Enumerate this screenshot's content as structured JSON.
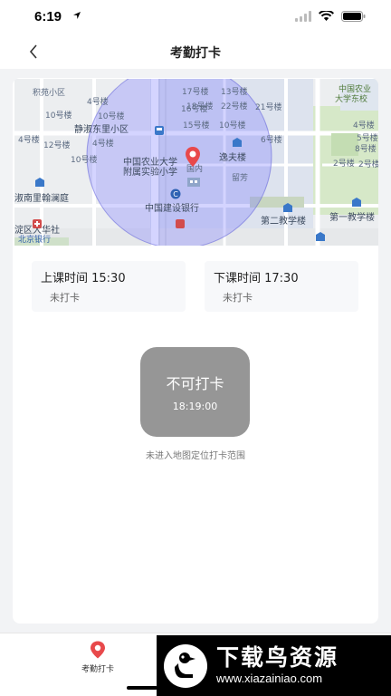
{
  "status_bar": {
    "time": "6:19",
    "icons": [
      "location-arrow-icon",
      "signal-icon",
      "wifi-icon",
      "battery-icon"
    ]
  },
  "nav": {
    "back_icon": "chevron-left-icon",
    "title": "考勤打卡"
  },
  "map": {
    "labels": [
      "积苑小区",
      "4号楼",
      "10号楼",
      "10号楼",
      "静淑东里小区",
      "4号楼",
      "12号楼",
      "4号楼",
      "10号楼",
      "中国农业大学",
      "附属实验小学",
      "中国建设银行",
      "淑南里翰澜庭",
      "淀区大华社",
      "北京银行",
      "17号楼",
      "13号楼",
      "18号楼",
      "22号楼",
      "16号楼",
      "21号楼",
      "15号楼",
      "10号楼",
      "6号楼",
      "逸夫楼",
      "留芳",
      "第二教学楼",
      "第一教学楼",
      "中国农业",
      "大学东校",
      "4号楼",
      "5号楼",
      "8号楼",
      "2号楼",
      "2号楼",
      "国内"
    ],
    "colors": {
      "circle_fill": "#7a7aff",
      "marker": "#e8494b"
    }
  },
  "class_start": {
    "label": "上课时间 15:30",
    "status": "未打卡"
  },
  "class_end": {
    "label": "下课时间 17:30",
    "status": "未打卡"
  },
  "punch_button": {
    "label": "不可打卡",
    "time": "18:19:00",
    "color": "#969696"
  },
  "hint": "未进入地图定位打卡范围",
  "tabbar": {
    "punch_tab_label": "考勤打卡",
    "punch_tab_icon": "location-pin-icon",
    "accent": "#e8494b"
  },
  "watermark": {
    "name": "下载鸟资源",
    "url": "www.xiazainiao.com",
    "logo_icon": "bird-logo-icon"
  }
}
